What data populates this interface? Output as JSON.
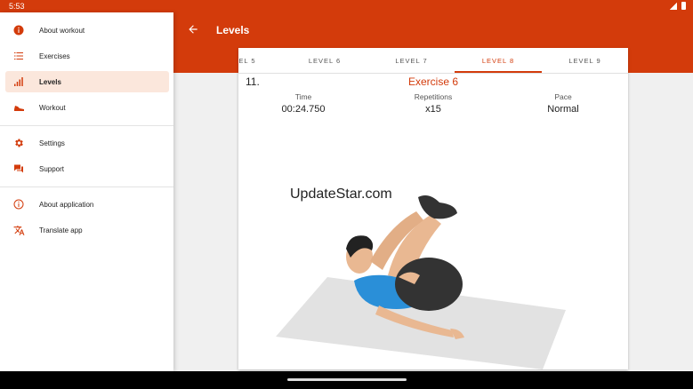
{
  "status": {
    "time": "5:53"
  },
  "appbar": {
    "title": "Levels"
  },
  "drawer": {
    "items": [
      {
        "label": "About workout",
        "icon": "info-icon"
      },
      {
        "label": "Exercises",
        "icon": "list-icon"
      },
      {
        "label": "Levels",
        "icon": "bar-chart-icon",
        "active": true
      },
      {
        "label": "Workout",
        "icon": "sneaker-icon"
      },
      {
        "label": "Settings",
        "icon": "gear-icon"
      },
      {
        "label": "Support",
        "icon": "chat-icon"
      },
      {
        "label": "About application",
        "icon": "info-outline-icon"
      },
      {
        "label": "Translate app",
        "icon": "translate-icon"
      }
    ]
  },
  "tabs": [
    "EL 5",
    "LEVEL 6",
    "LEVEL 7",
    "LEVEL 8",
    "LEVEL 9"
  ],
  "active_tab": "LEVEL 8",
  "exercise": {
    "number": "11.",
    "title": "Exercise 6",
    "time_label": "Time",
    "time_value": "00:24.750",
    "reps_label": "Repetitions",
    "reps_value": "x15",
    "pace_label": "Pace",
    "pace_value": "Normal"
  },
  "watermark": "UpdateStar.com",
  "colors": {
    "accent": "#d33b0b",
    "active_bg": "#fbe7dc"
  }
}
